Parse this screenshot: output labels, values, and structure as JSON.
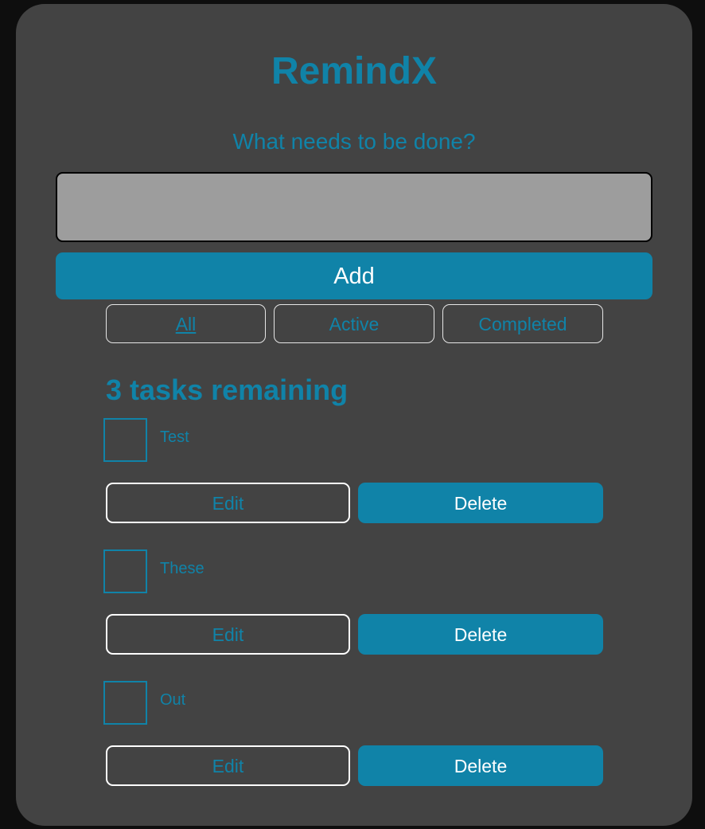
{
  "app": {
    "title": "RemindX",
    "prompt": "What needs to be done?"
  },
  "new_task": {
    "value": "",
    "placeholder": "",
    "add_label": "Add"
  },
  "filters": [
    {
      "label": "All",
      "selected": true
    },
    {
      "label": "Active",
      "selected": false
    },
    {
      "label": "Completed",
      "selected": false
    }
  ],
  "remaining_text": "3 tasks remaining",
  "tasks": [
    {
      "name": "Test",
      "completed": false,
      "edit_label": "Edit",
      "delete_label": "Delete"
    },
    {
      "name": "These",
      "completed": false,
      "edit_label": "Edit",
      "delete_label": "Delete"
    },
    {
      "name": "Out",
      "completed": false,
      "edit_label": "Edit",
      "delete_label": "Delete"
    }
  ],
  "colors": {
    "accent": "#1083a8",
    "card_background": "#434343",
    "page_background": "#0e0e0e",
    "input_background": "#9d9d9d",
    "button_text": "#ffffff"
  }
}
